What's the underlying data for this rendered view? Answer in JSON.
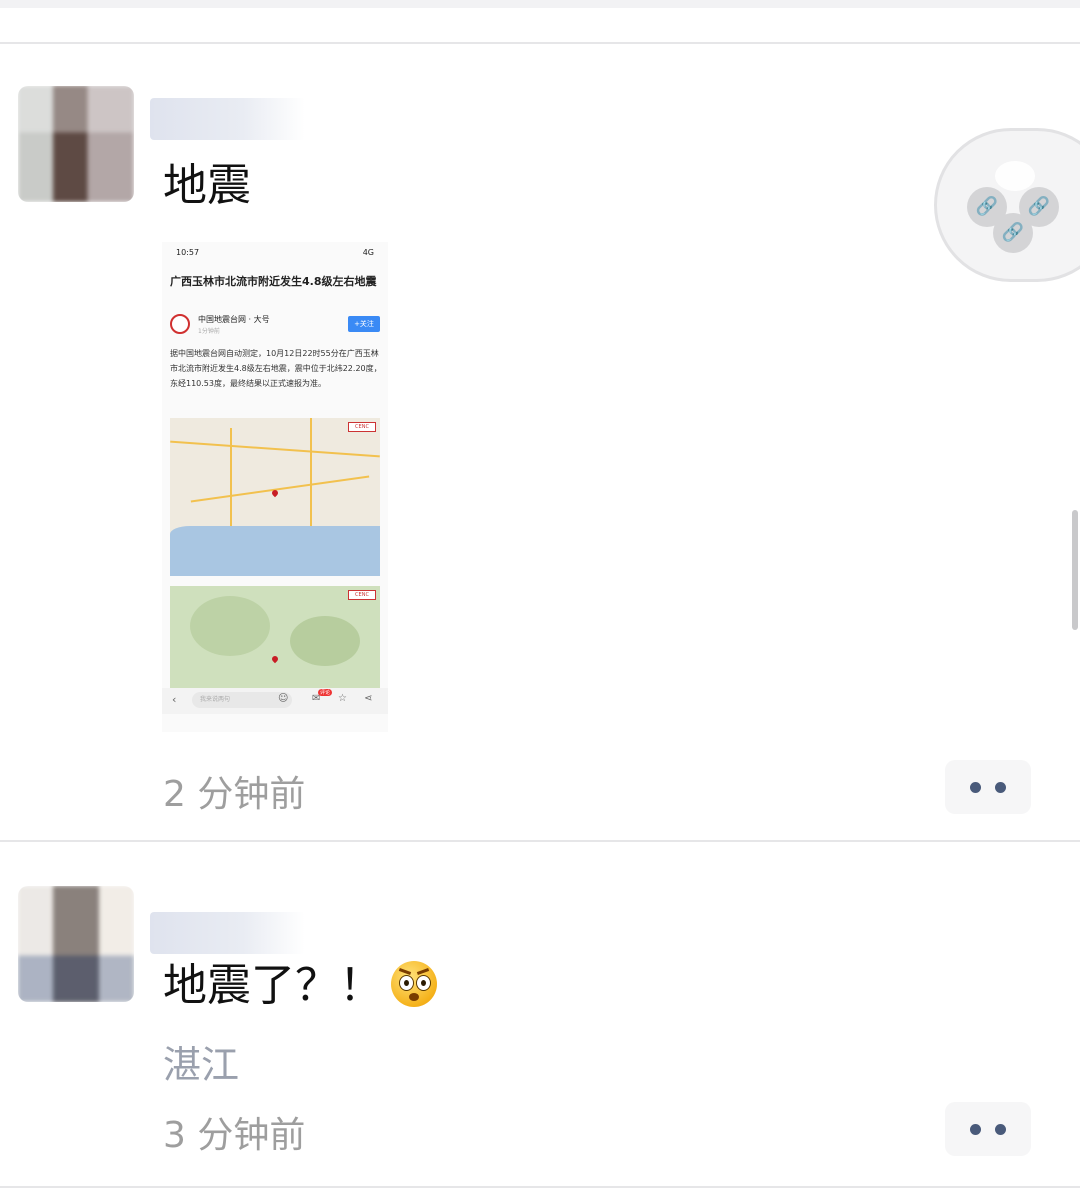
{
  "feed": {
    "post1": {
      "text": "地震",
      "time": "2 分钟前",
      "screenshot": {
        "status_time": "10:57",
        "status_right": "4G",
        "headline": "广西玉林市北流市附近发生4.8级左右地震",
        "source_name": "中国地震台网",
        "source_sub": "大号",
        "source_time": "1分钟前",
        "follow_label": "+关注",
        "body": "据中国地震台网自动测定，10月12日22时55分在广西玉林市北流市附近发生4.8级左右地震，震中位于北纬22.20度，东经110.53度，最终结果以正式速报为准。",
        "map_logo": "CENC",
        "comment_placeholder": "我来说两句",
        "comment_badge": "评论"
      }
    },
    "post2": {
      "text": "地震了？！",
      "emoji": "astonished-face",
      "location": "湛江",
      "time": "3 分钟前"
    }
  },
  "colors": {
    "name_blue": "#576b95",
    "time_gray": "#9e9e9e",
    "location_gray": "#9aa0ad",
    "more_dots": "#495a7a"
  }
}
